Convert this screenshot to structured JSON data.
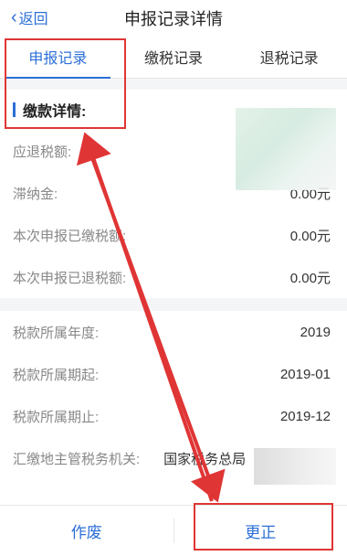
{
  "nav": {
    "back_label": "返回",
    "title": "申报记录详情"
  },
  "tabs": [
    {
      "label": "申报记录"
    },
    {
      "label": "缴税记录"
    },
    {
      "label": "退税记录"
    }
  ],
  "section": {
    "title": "缴款详情:"
  },
  "rows1": [
    {
      "label": "应退税额:",
      "value": ""
    },
    {
      "label": "滞纳金:",
      "value": "0.00元"
    },
    {
      "label": "本次申报已缴税额:",
      "value": "0.00元"
    },
    {
      "label": "本次申报已退税额:",
      "value": "0.00元"
    }
  ],
  "rows2": [
    {
      "label": "税款所属年度:",
      "value": "2019"
    },
    {
      "label": "税款所属期起:",
      "value": "2019-01"
    },
    {
      "label": "税款所属期止:",
      "value": "2019-12"
    },
    {
      "label": "汇缴地主管税务机关:",
      "value": "国家税务总局"
    }
  ],
  "footer": {
    "void_label": "作废",
    "correct_label": "更正"
  },
  "colors": {
    "accent": "#2c6fd6",
    "annotation": "#e03535"
  }
}
